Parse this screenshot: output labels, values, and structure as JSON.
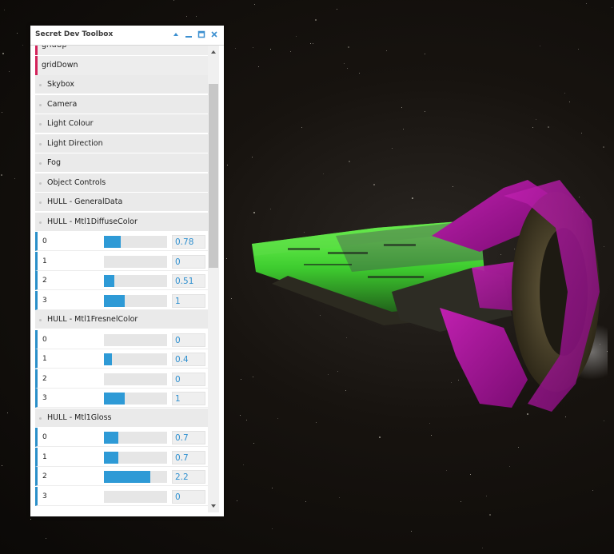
{
  "toolbox": {
    "title": "Secret Dev Toolbox",
    "buttons": [
      "collapse-icon",
      "minimize-icon",
      "maximize-icon",
      "close-icon"
    ]
  },
  "rows": [
    {
      "kind": "pink",
      "label": "gridUp"
    },
    {
      "kind": "pink",
      "label": "gridDown"
    },
    {
      "kind": "group",
      "label": "Skybox"
    },
    {
      "kind": "group",
      "label": "Camera"
    },
    {
      "kind": "group",
      "label": "Light Colour"
    },
    {
      "kind": "group",
      "label": "Light Direction"
    },
    {
      "kind": "group",
      "label": "Fog"
    },
    {
      "kind": "group",
      "label": "Object Controls"
    },
    {
      "kind": "group",
      "label": "HULL - GeneralData"
    },
    {
      "kind": "group",
      "label": "HULL - Mtl1DiffuseColor"
    },
    {
      "kind": "prop",
      "index": "0",
      "value": "0.78",
      "fill": 0.26
    },
    {
      "kind": "prop",
      "index": "1",
      "value": "0",
      "fill": 0
    },
    {
      "kind": "prop",
      "index": "2",
      "value": "0.51",
      "fill": 0.17
    },
    {
      "kind": "prop",
      "index": "3",
      "value": "1",
      "fill": 0.33
    },
    {
      "kind": "group",
      "label": "HULL - Mtl1FresnelColor"
    },
    {
      "kind": "prop",
      "index": "0",
      "value": "0",
      "fill": 0
    },
    {
      "kind": "prop",
      "index": "1",
      "value": "0.4",
      "fill": 0.13
    },
    {
      "kind": "prop",
      "index": "2",
      "value": "0",
      "fill": 0
    },
    {
      "kind": "prop",
      "index": "3",
      "value": "1",
      "fill": 0.33
    },
    {
      "kind": "group",
      "label": "HULL - Mtl1Gloss"
    },
    {
      "kind": "prop",
      "index": "0",
      "value": "0.7",
      "fill": 0.23
    },
    {
      "kind": "prop",
      "index": "1",
      "value": "0.7",
      "fill": 0.23
    },
    {
      "kind": "prop",
      "index": "2",
      "value": "2.2",
      "fill": 0.73
    },
    {
      "kind": "prop",
      "index": "3",
      "value": "0",
      "fill": 0
    }
  ],
  "colors": {
    "accent_blue": "#2e9ad6",
    "value_text": "#2e8fcf",
    "pink_marker": "#d3225a",
    "group_bg": "#eaeaea"
  }
}
